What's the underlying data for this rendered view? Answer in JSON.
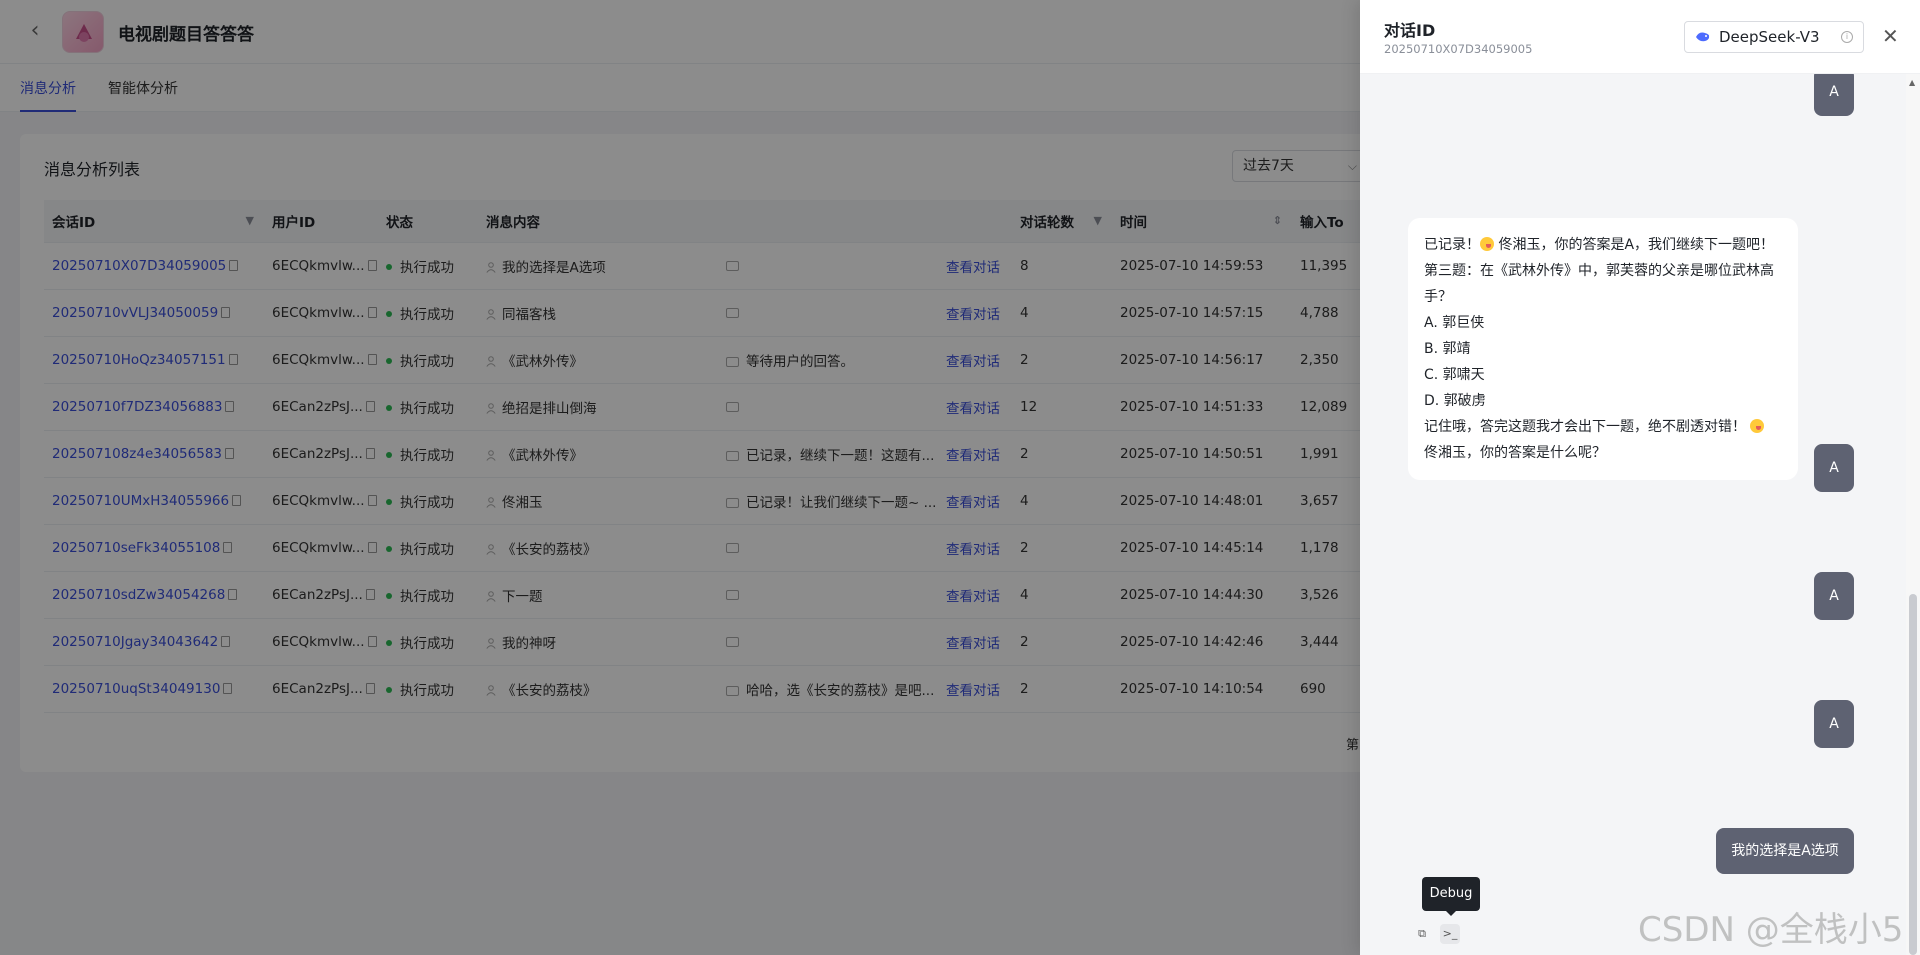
{
  "app": {
    "title": "电视剧题目答答答"
  },
  "tabs": [
    {
      "label": "消息分析",
      "active": true
    },
    {
      "label": "智能体分析",
      "active": false
    }
  ],
  "list": {
    "title": "消息分析列表",
    "range": "过去7天",
    "columns": [
      "会话ID",
      "用户ID",
      "状态",
      "消息内容",
      "对话轮数",
      "时间",
      "输入To"
    ],
    "view_label": "查看对话",
    "pager_text": "第",
    "rows": [
      {
        "session": "20250710X07D34059005",
        "user": "6ECQkmvlw...",
        "status": "执行成功",
        "msg": "我的选择是A选项",
        "reply": "",
        "rounds": "8",
        "time": "2025-07-10 14:59:53",
        "tokens": "11,395"
      },
      {
        "session": "20250710vVLJ34050059",
        "user": "6ECQkmvlw...",
        "status": "执行成功",
        "msg": "同福客栈",
        "reply": "",
        "rounds": "4",
        "time": "2025-07-10 14:57:15",
        "tokens": "4,788"
      },
      {
        "session": "20250710HoQz34057151",
        "user": "6ECQkmvlw...",
        "status": "执行成功",
        "msg": "《武林外传》",
        "reply": "等待用户的回答。",
        "rounds": "2",
        "time": "2025-07-10 14:56:17",
        "tokens": "2,350"
      },
      {
        "session": "20250710f7DZ34056883",
        "user": "6ECan2zPsJ...",
        "status": "执行成功",
        "msg": "绝招是排山倒海",
        "reply": "",
        "rounds": "12",
        "time": "2025-07-10 14:51:33",
        "tokens": "12,089"
      },
      {
        "session": "202507108z4e34056583",
        "user": "6ECan2zPsJ...",
        "status": "执行成功",
        "msg": "《武林外传》",
        "reply": "已记录，继续下一题！这题有...",
        "rounds": "2",
        "time": "2025-07-10 14:50:51",
        "tokens": "1,991"
      },
      {
        "session": "20250710UMxH34055966",
        "user": "6ECQkmvlw...",
        "status": "执行成功",
        "msg": "佟湘玉",
        "reply": "已记录！让我们继续下一题~ ...",
        "rounds": "4",
        "time": "2025-07-10 14:48:01",
        "tokens": "3,657"
      },
      {
        "session": "20250710seFk34055108",
        "user": "6ECQkmvlw...",
        "status": "执行成功",
        "msg": "《长安的荔枝》",
        "reply": "",
        "rounds": "2",
        "time": "2025-07-10 14:45:14",
        "tokens": "1,178"
      },
      {
        "session": "20250710sdZw34054268",
        "user": "6ECan2zPsJ...",
        "status": "执行成功",
        "msg": "下一题",
        "reply": "",
        "rounds": "4",
        "time": "2025-07-10 14:44:30",
        "tokens": "3,526"
      },
      {
        "session": "20250710Jgay34043642",
        "user": "6ECQkmvlw...",
        "status": "执行成功",
        "msg": "我的神呀",
        "reply": "",
        "rounds": "2",
        "time": "2025-07-10 14:42:46",
        "tokens": "3,444"
      },
      {
        "session": "20250710uqSt34049130",
        "user": "6ECan2zPsJ...",
        "status": "执行成功",
        "msg": "《长安的荔枝》",
        "reply": "哈哈，选《长安的荔枝》是吧...",
        "rounds": "2",
        "time": "2025-07-10 14:10:54",
        "tokens": "690"
      }
    ]
  },
  "drawer": {
    "title": "对话ID",
    "session_id": "20250710X07D34059005",
    "model": "DeepSeek-V3",
    "avatar_letter": "A",
    "bot_message": {
      "line1_a": "已记录！",
      "line1_b": " 佟湘玉，你的答案是A，我们继续下一题吧！",
      "line2": "第三题：在《武林外传》中，郭芙蓉的父亲是哪位武林高手？",
      "opt_a": "A. 郭巨侠",
      "opt_b": "B. 郭靖",
      "opt_c": "C. 郭啸天",
      "opt_d": "D. 郭破虏",
      "line3_a": "记住哦，答完这题我才会出下一题，绝不剧透对错！",
      "line3_b": "佟湘玉，你的答案是什么呢？"
    },
    "user_message": "我的选择是A选项",
    "tooltip": "Debug"
  },
  "watermark": "CSDN @全栈小5",
  "colors": {
    "accent": "#3b4fd9",
    "success": "#2dbb55",
    "user_bubble": "#5e6272"
  }
}
